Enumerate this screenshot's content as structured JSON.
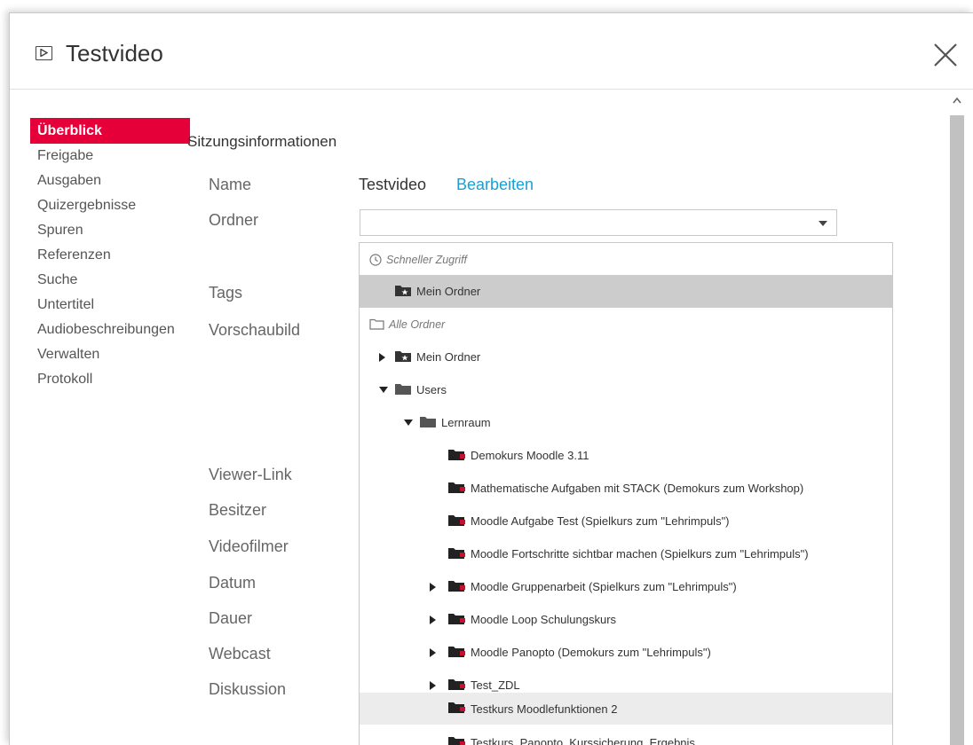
{
  "dialog": {
    "title": "Testvideo",
    "title_icon": "play-box-icon",
    "close_icon": "close-icon"
  },
  "sidebar": {
    "items": [
      {
        "label": "Überblick",
        "active": true
      },
      {
        "label": "Freigabe"
      },
      {
        "label": "Ausgaben"
      },
      {
        "label": "Quizergebnisse"
      },
      {
        "label": "Spuren"
      },
      {
        "label": "Referenzen"
      },
      {
        "label": "Suche"
      },
      {
        "label": "Untertitel"
      },
      {
        "label": "Audiobeschreibungen"
      },
      {
        "label": "Verwalten"
      },
      {
        "label": "Protokoll"
      }
    ]
  },
  "main": {
    "section_title": "Sitzungsinformationen",
    "labels": {
      "name": "Name",
      "folder": "Ordner",
      "tags": "Tags",
      "thumbnail": "Vorschaubild",
      "viewer_link": "Viewer-Link",
      "owner": "Besitzer",
      "videographer": "Videofilmer",
      "date": "Datum",
      "duration": "Dauer",
      "webcast": "Webcast",
      "discussion": "Diskussion"
    },
    "name_value": "Testvideo",
    "edit_link": "Bearbeiten",
    "folder_value": ""
  },
  "dropdown": {
    "quick_access_header": "Schneller Zugriff",
    "quick_access_item": "Mein Ordner",
    "all_folders_header": "Alle Ordner",
    "tree": [
      {
        "label": "Mein Ordner",
        "expander": "collapsed",
        "icon": "folder-star-icon"
      },
      {
        "label": "Users",
        "expander": "expanded",
        "icon": "folder-icon"
      },
      {
        "label": "Lernraum",
        "expander": "expanded",
        "icon": "folder-icon"
      },
      {
        "label": "Demokurs Moodle 3.11",
        "expander": "none",
        "icon": "folder-course-icon"
      },
      {
        "label": "Mathematische Aufgaben mit STACK (Demokurs zum Workshop)",
        "expander": "none",
        "icon": "folder-course-icon"
      },
      {
        "label": "Moodle Aufgabe Test (Spielkurs zum \"Lehrimpuls\")",
        "expander": "none",
        "icon": "folder-course-icon"
      },
      {
        "label": "Moodle Fortschritte sichtbar machen (Spielkurs zum \"Lehrimpuls\")",
        "expander": "none",
        "icon": "folder-course-icon"
      },
      {
        "label": "Moodle Gruppenarbeit (Spielkurs zum \"Lehrimpuls\")",
        "expander": "collapsed",
        "icon": "folder-course-icon"
      },
      {
        "label": "Moodle Loop Schulungskurs",
        "expander": "collapsed",
        "icon": "folder-course-icon"
      },
      {
        "label": "Moodle Panopto (Demokurs zum \"Lehrimpuls\")",
        "expander": "collapsed",
        "icon": "folder-course-icon"
      },
      {
        "label": "Test_ZDL",
        "expander": "collapsed",
        "icon": "folder-course-icon"
      },
      {
        "label": "Testkurs Moodlefunktionen 2",
        "expander": "none",
        "icon": "folder-course-icon"
      },
      {
        "label": "Testkurs_Panopto_Kurssicherung_Ergebnis",
        "expander": "none",
        "icon": "folder-course-icon"
      }
    ]
  },
  "colors": {
    "accent": "#e6003a",
    "link": "#1a9fd6",
    "highlight_row": "#cccccc",
    "hover_row": "#ececec"
  }
}
